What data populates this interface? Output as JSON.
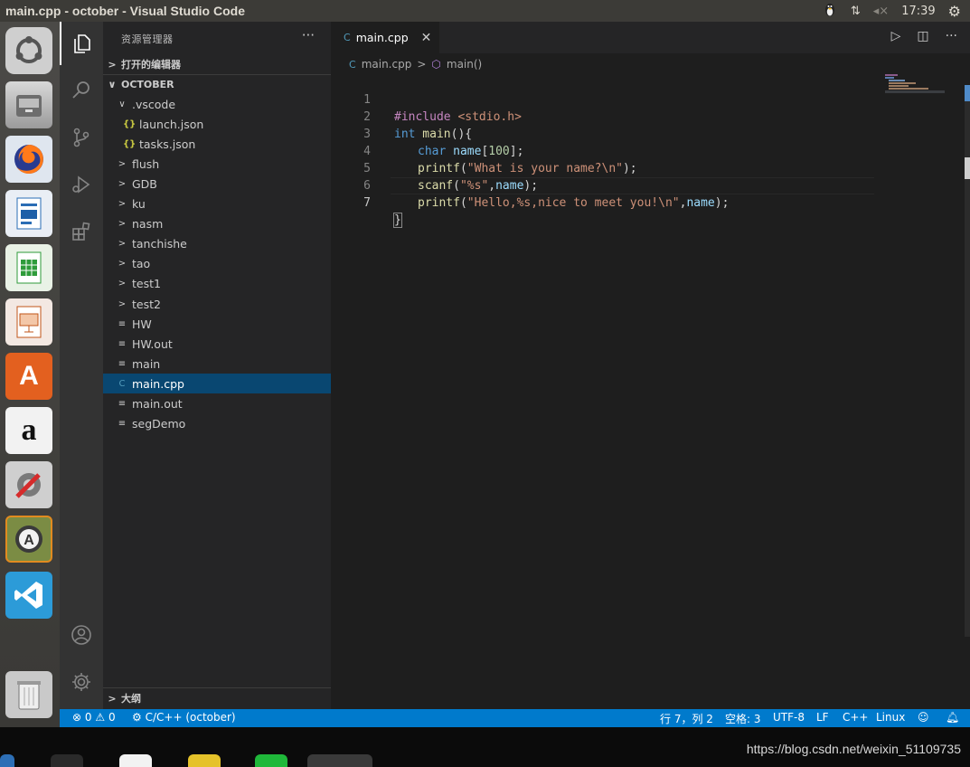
{
  "window": {
    "title": "main.cpp - october - Visual Studio Code"
  },
  "tray": {
    "network_icon": "updown-arrows-icon",
    "volume_icon": "volume-mute-icon",
    "time": "17:39"
  },
  "launcher": {
    "apps": [
      "ubuntu-icon",
      "files-icon",
      "firefox-icon",
      "writer-icon",
      "calc-icon",
      "impress-icon",
      "software-center-icon",
      "amazon-icon",
      "settings-tools-icon",
      "updater-icon",
      "vscode-icon",
      "trash-icon"
    ]
  },
  "explorer": {
    "title": "资源管理器",
    "more": "···",
    "open_editors": "打开的编辑器",
    "folder": "OCTOBER",
    "outline": "大纲",
    "items": [
      {
        "label": ".vscode",
        "kind": "folder-open",
        "indent": 1
      },
      {
        "label": "launch.json",
        "kind": "json",
        "indent": 2
      },
      {
        "label": "tasks.json",
        "kind": "json",
        "indent": 2
      },
      {
        "label": "flush",
        "kind": "folder",
        "indent": 1
      },
      {
        "label": "GDB",
        "kind": "folder",
        "indent": 1
      },
      {
        "label": "ku",
        "kind": "folder",
        "indent": 1
      },
      {
        "label": "nasm",
        "kind": "folder",
        "indent": 1
      },
      {
        "label": "tanchishe",
        "kind": "folder",
        "indent": 1
      },
      {
        "label": "tao",
        "kind": "folder",
        "indent": 1
      },
      {
        "label": "test1",
        "kind": "folder",
        "indent": 1
      },
      {
        "label": "test2",
        "kind": "folder",
        "indent": 1
      },
      {
        "label": "HW",
        "kind": "file",
        "indent": 1
      },
      {
        "label": "HW.out",
        "kind": "file",
        "indent": 1
      },
      {
        "label": "main",
        "kind": "file",
        "indent": 1
      },
      {
        "label": "main.cpp",
        "kind": "cpp",
        "indent": 1,
        "selected": true
      },
      {
        "label": "main.out",
        "kind": "file",
        "indent": 1
      },
      {
        "label": "segDemo",
        "kind": "file",
        "indent": 1
      }
    ]
  },
  "editor": {
    "tab_label": "main.cpp",
    "breadcrumb_file": "main.cpp",
    "breadcrumb_symbol": "main()",
    "line_numbers": [
      "1",
      "2",
      "3",
      "4",
      "5",
      "6",
      "7"
    ],
    "code": {
      "l1_include": "#include",
      "l1_header": " <stdio.h>",
      "l2_int": "int",
      "l2_main": " main",
      "l2_paren": "(){",
      "l3_char": "char",
      "l3_name": " name",
      "l3_b1": "[",
      "l3_num": "100",
      "l3_b2": "];",
      "l4_fn": "printf",
      "l4_p1": "(",
      "l4_str": "\"What is your name?\\n\"",
      "l4_p2": ");",
      "l5_fn": "scanf",
      "l5_p1": "(",
      "l5_str": "\"%s\"",
      "l5_comma": ",",
      "l5_var": "name",
      "l5_p2": ");",
      "l6_fn": "printf",
      "l6_p1": "(",
      "l6_str": "\"Hello,%s,nice to meet you!\\n\"",
      "l6_comma": ",",
      "l6_var": "name",
      "l6_p2": ");",
      "l7_brace": "}"
    }
  },
  "statusbar": {
    "errors": "0",
    "warnings": "0",
    "config": "C/C++ (october)",
    "position": "行 7，列 2",
    "spaces": "空格: 3",
    "encoding": "UTF-8",
    "eol": "LF",
    "language": "C++",
    "os": "Linux"
  },
  "taskbar": {
    "watermark": "https://blog.csdn.net/weixin_51109735"
  }
}
